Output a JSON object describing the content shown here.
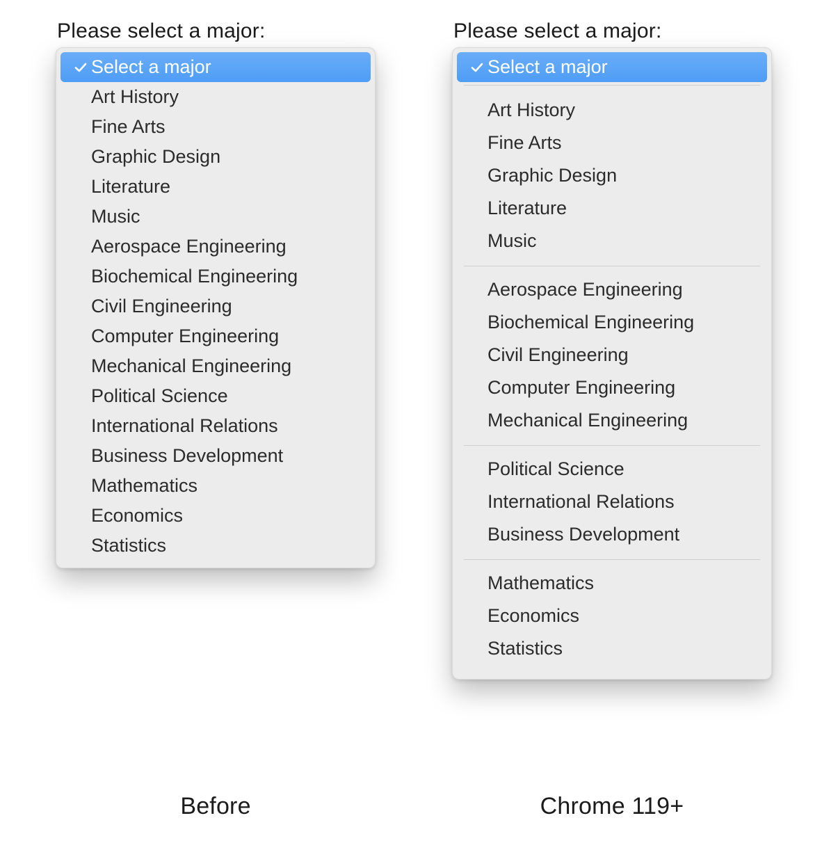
{
  "prompt": "Please select a major:",
  "selected_label": "Select a major",
  "left": {
    "caption": "Before",
    "items": [
      "Art History",
      "Fine Arts",
      "Graphic Design",
      "Literature",
      "Music",
      "Aerospace Engineering",
      "Biochemical Engineering",
      "Civil Engineering",
      "Computer Engineering",
      "Mechanical Engineering",
      "Political Science",
      "International Relations",
      "Business Development",
      "Mathematics",
      "Economics",
      "Statistics"
    ]
  },
  "right": {
    "caption": "Chrome 119+",
    "groups": [
      [
        "Art History",
        "Fine Arts",
        "Graphic Design",
        "Literature",
        "Music"
      ],
      [
        "Aerospace Engineering",
        "Biochemical Engineering",
        "Civil Engineering",
        "Computer Engineering",
        "Mechanical Engineering"
      ],
      [
        "Political Science",
        "International Relations",
        "Business Development"
      ],
      [
        "Mathematics",
        "Economics",
        "Statistics"
      ]
    ]
  },
  "colors": {
    "highlight": "#4e9df6",
    "panel": "#ececec"
  }
}
